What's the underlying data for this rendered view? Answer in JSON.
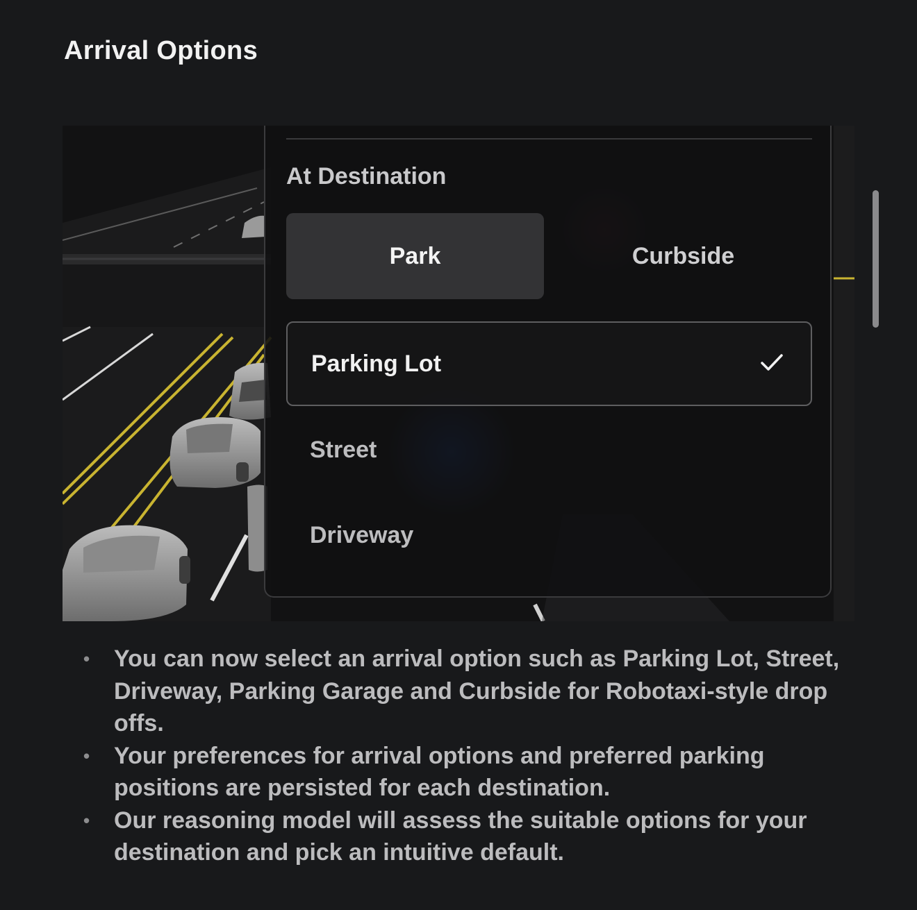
{
  "page": {
    "title": "Arrival Options"
  },
  "panel": {
    "section_heading": "At Destination",
    "segments": [
      {
        "label": "Park",
        "active": true
      },
      {
        "label": "Curbside",
        "active": false
      }
    ],
    "options": [
      {
        "label": "Parking Lot",
        "selected": true
      },
      {
        "label": "Street",
        "selected": false
      },
      {
        "label": "Driveway",
        "selected": false
      }
    ],
    "check_icon": "checkmark-icon"
  },
  "notes": [
    "You can now select an arrival option such as Parking Lot, Street, Driveway, Parking Garage and Curbside for Robotaxi-style drop offs.",
    "Your preferences for arrival options and preferred parking positions are persisted for each destination.",
    "Our reasoning model will assess the suitable options for your destination and pick an intuitive default."
  ],
  "colors": {
    "background": "#18191b",
    "lane_yellow": "#c9b431",
    "active_segment": "#333335"
  }
}
